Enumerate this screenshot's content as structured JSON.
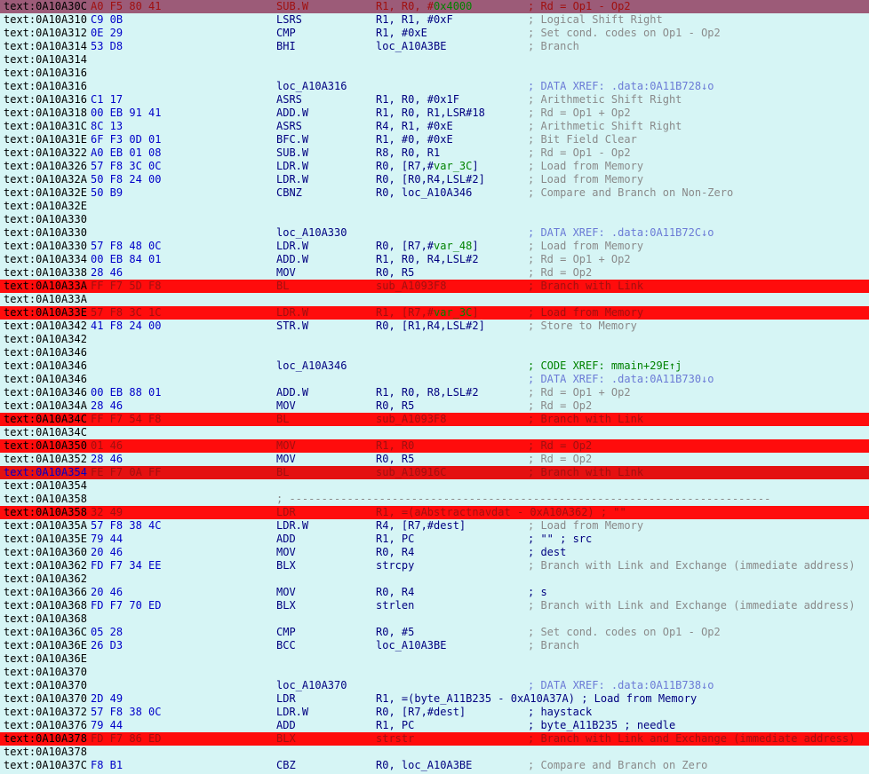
{
  "rows": [
    {
      "addr": "text:0A10A30C",
      "bytes": "A0 F5 80 41",
      "mn": "SUB.W",
      "ops": "R1, R0, #",
      "var": "0x4000",
      "cmt": "; Rd = Op1 - Op2",
      "hl": "cursor"
    },
    {
      "addr": "text:0A10A310",
      "bytes": "C9 0B",
      "mn": "LSRS",
      "ops": "R1, R1, #0xF",
      "cmt": "; Logical Shift Right"
    },
    {
      "addr": "text:0A10A312",
      "bytes": "0E 29",
      "mn": "CMP",
      "ops": "R1, #0xE",
      "cmt": "; Set cond. codes on Op1 - Op2"
    },
    {
      "addr": "text:0A10A314",
      "bytes": "53 D8",
      "mn": "BHI",
      "ops": "loc_A10A3BE",
      "cmt": "; Branch"
    },
    {
      "addr": "text:0A10A314"
    },
    {
      "addr": "text:0A10A316"
    },
    {
      "addr": "text:0A10A316",
      "label": "loc_A10A316",
      "cmt": "; DATA XREF: .data:0A11B728↓o",
      "ctype": "xref"
    },
    {
      "addr": "text:0A10A316",
      "bytes": "C1 17",
      "mn": "ASRS",
      "ops": "R1, R0, #0x1F",
      "cmt": "; Arithmetic Shift Right"
    },
    {
      "addr": "text:0A10A318",
      "bytes": "00 EB 91 41",
      "mn": "ADD.W",
      "ops": "R1, R0, R1,LSR#18",
      "cmt": "; Rd = Op1 + Op2"
    },
    {
      "addr": "text:0A10A31C",
      "bytes": "8C 13",
      "mn": "ASRS",
      "ops": "R4, R1, #0xE",
      "cmt": "; Arithmetic Shift Right"
    },
    {
      "addr": "text:0A10A31E",
      "bytes": "6F F3 0D 01",
      "mn": "BFC.W",
      "ops": "R1, #0, #0xE",
      "cmt": "; Bit Field Clear"
    },
    {
      "addr": "text:0A10A322",
      "bytes": "A0 EB 01 08",
      "mn": "SUB.W",
      "ops": "R8, R0, R1",
      "cmt": "; Rd = Op1 - Op2"
    },
    {
      "addr": "text:0A10A326",
      "bytes": "57 F8 3C 0C",
      "mn": "LDR.W",
      "ops": "R0, [R7,#",
      "var": "var_3C",
      "ops2": "]",
      "cmt": "; Load from Memory"
    },
    {
      "addr": "text:0A10A32A",
      "bytes": "50 F8 24 00",
      "mn": "LDR.W",
      "ops": "R0, [R0,R4,LSL#2]",
      "cmt": "; Load from Memory"
    },
    {
      "addr": "text:0A10A32E",
      "bytes": "50 B9",
      "mn": "CBNZ",
      "ops": "R0, loc_A10A346",
      "cmt": "; Compare and Branch on Non-Zero"
    },
    {
      "addr": "text:0A10A32E"
    },
    {
      "addr": "text:0A10A330"
    },
    {
      "addr": "text:0A10A330",
      "label": "loc_A10A330",
      "cmt": "; DATA XREF: .data:0A11B72C↓o",
      "ctype": "xref"
    },
    {
      "addr": "text:0A10A330",
      "bytes": "57 F8 48 0C",
      "mn": "LDR.W",
      "ops": "R0, [R7,#",
      "var": "var_48",
      "ops2": "]",
      "cmt": "; Load from Memory"
    },
    {
      "addr": "text:0A10A334",
      "bytes": "00 EB 84 01",
      "mn": "ADD.W",
      "ops": "R1, R0, R4,LSL#2",
      "cmt": "; Rd = Op1 + Op2"
    },
    {
      "addr": "text:0A10A338",
      "bytes": "28 46",
      "mn": "MOV",
      "ops": "R0, R5",
      "cmt": "; Rd = Op2"
    },
    {
      "addr": "text:0A10A33A",
      "bytes": "FF F7 5D F8",
      "mn": "BL",
      "ops": "sub_A1093F8",
      "cmt": "; Branch with Link",
      "hl": "red"
    },
    {
      "addr": "text:0A10A33A"
    },
    {
      "addr": "text:0A10A33E",
      "bytes": "57 F8 3C 1C",
      "mn": "LDR.W",
      "ops": "R1, [R7,#",
      "var": "var_3C",
      "ops2": "]",
      "cmt": "; Load from Memory",
      "hl": "red"
    },
    {
      "addr": "text:0A10A342",
      "bytes": "41 F8 24 00",
      "mn": "STR.W",
      "ops": "R0, [R1,R4,LSL#2]",
      "cmt": "; Store to Memory"
    },
    {
      "addr": "text:0A10A342"
    },
    {
      "addr": "text:0A10A346"
    },
    {
      "addr": "text:0A10A346",
      "label": "loc_A10A346",
      "cmt": "; CODE XREF: mmain+29E↑j",
      "ctype": "code"
    },
    {
      "addr": "text:0A10A346",
      "cmt": "; DATA XREF: .data:0A11B730↓o",
      "ctype": "xref"
    },
    {
      "addr": "text:0A10A346",
      "bytes": "00 EB 88 01",
      "mn": "ADD.W",
      "ops": "R1, R0, R8,LSL#2",
      "cmt": "; Rd = Op1 + Op2"
    },
    {
      "addr": "text:0A10A34A",
      "bytes": "28 46",
      "mn": "MOV",
      "ops": "R0, R5",
      "cmt": "; Rd = Op2"
    },
    {
      "addr": "text:0A10A34C",
      "bytes": "FF F7 54 F8",
      "mn": "BL",
      "ops": "sub_A1093F8",
      "cmt": "; Branch with Link",
      "hl": "red"
    },
    {
      "addr": "text:0A10A34C"
    },
    {
      "addr": "text:0A10A350",
      "bytes": "01 46",
      "mn": "MOV",
      "ops": "R1, R0",
      "cmt": "; Rd = Op2",
      "hl": "red"
    },
    {
      "addr": "text:0A10A352",
      "bytes": "28 46",
      "mn": "MOV",
      "ops": "R0, R5",
      "cmt": "; Rd = Op2"
    },
    {
      "addr": "text:0A10A354",
      "bytes": "FE F7 0A FF",
      "mn": "BL",
      "ops": "sub_A10916C",
      "cmt": "; Branch with Link",
      "hl": "dark"
    },
    {
      "addr": "text:0A10A354"
    },
    {
      "addr": "text:0A10A358",
      "sep": "; ---------------------------------------------------------------------------"
    },
    {
      "addr": "text:0A10A358",
      "bytes": "32 49",
      "mn": "LDR",
      "ops": "R1, =(aAbstractnavdat - 0xA10A362) ; \"\"",
      "hl": "red"
    },
    {
      "addr": "text:0A10A35A",
      "bytes": "57 F8 38 4C",
      "mn": "LDR.W",
      "ops": "R4, [R7,#dest]",
      "cmt": "; Load from Memory"
    },
    {
      "addr": "text:0A10A35E",
      "bytes": "79 44",
      "mn": "ADD",
      "ops": "R1, PC",
      "cmt": "; \"\" ; src",
      "ctype": "name"
    },
    {
      "addr": "text:0A10A360",
      "bytes": "20 46",
      "mn": "MOV",
      "ops": "R0, R4",
      "cmt": "; dest",
      "ctype": "name"
    },
    {
      "addr": "text:0A10A362",
      "bytes": "FD F7 34 EE",
      "mn": "BLX",
      "ops": "strcpy",
      "cmt": "; Branch with Link and Exchange (immediate address)"
    },
    {
      "addr": "text:0A10A362"
    },
    {
      "addr": "text:0A10A366",
      "bytes": "20 46",
      "mn": "MOV",
      "ops": "R0, R4",
      "cmt": "; s",
      "ctype": "name"
    },
    {
      "addr": "text:0A10A368",
      "bytes": "FD F7 70 ED",
      "mn": "BLX",
      "ops": "strlen",
      "cmt": "; Branch with Link and Exchange (immediate address)"
    },
    {
      "addr": "text:0A10A368"
    },
    {
      "addr": "text:0A10A36C",
      "bytes": "05 28",
      "mn": "CMP",
      "ops": "R0, #5",
      "cmt": "; Set cond. codes on Op1 - Op2"
    },
    {
      "addr": "text:0A10A36E",
      "bytes": "26 D3",
      "mn": "BCC",
      "ops": "loc_A10A3BE",
      "cmt": "; Branch"
    },
    {
      "addr": "text:0A10A36E"
    },
    {
      "addr": "text:0A10A370"
    },
    {
      "addr": "text:0A10A370",
      "label": "loc_A10A370",
      "cmt": "; DATA XREF: .data:0A11B738↓o",
      "ctype": "xref"
    },
    {
      "addr": "text:0A10A370",
      "bytes": "2D 49",
      "mn": "LDR",
      "ops": "R1, =(byte_A11B235 - 0xA10A37A) ; Load from Memory"
    },
    {
      "addr": "text:0A10A372",
      "bytes": "57 F8 38 0C",
      "mn": "LDR.W",
      "ops": "R0, [R7,#dest]",
      "cmt": "; haystack",
      "ctype": "name"
    },
    {
      "addr": "text:0A10A376",
      "bytes": "79 44",
      "mn": "ADD",
      "ops": "R1, PC",
      "cmt": "; byte_A11B235 ; needle",
      "ctype": "name"
    },
    {
      "addr": "text:0A10A378",
      "bytes": "FD F7 86 ED",
      "mn": "BLX",
      "ops": "strstr",
      "cmt": "; Branch with Link and Exchange (immediate address)",
      "hl": "red"
    },
    {
      "addr": "text:0A10A378"
    },
    {
      "addr": "text:0A10A37C",
      "bytes": "F8 B1",
      "mn": "CBZ",
      "ops": "R0, loc_A10A3BE",
      "cmt": "; Compare and Branch on Zero"
    }
  ]
}
